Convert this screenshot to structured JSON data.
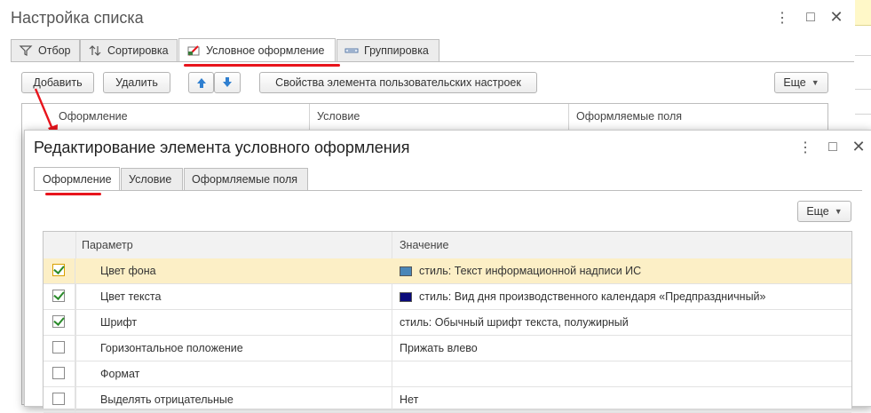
{
  "outer_window": {
    "title": "Настройка списка",
    "tabs": [
      {
        "label": "Отбор",
        "icon": "filter-icon"
      },
      {
        "label": "Сортировка",
        "icon": "sort-icon"
      },
      {
        "label": "Условное оформление",
        "icon": "conditional-format-icon",
        "active": true
      },
      {
        "label": "Группировка",
        "icon": "grouping-icon"
      }
    ],
    "toolbar": {
      "add": "Добавить",
      "delete": "Удалить",
      "properties": "Свойства элемента пользовательских настроек",
      "more": "Еще"
    },
    "columns": [
      "Оформление",
      "Условие",
      "Оформляемые поля"
    ]
  },
  "dialog": {
    "title": "Редактирование элемента условного оформления",
    "tabs": [
      {
        "label": "Оформление",
        "active": true
      },
      {
        "label": "Условие"
      },
      {
        "label": "Оформляемые поля"
      }
    ],
    "more": "Еще",
    "columns": {
      "param": "Параметр",
      "value": "Значение"
    },
    "rows": [
      {
        "checked": true,
        "param": "Цвет фона",
        "value": "стиль: Текст информационной надписи ИС",
        "swatch": "#4a86b8",
        "selected": true
      },
      {
        "checked": true,
        "param": "Цвет текста",
        "value": "стиль: Вид дня производственного календаря «Предпраздничный»",
        "swatch": "#0a0a7a"
      },
      {
        "checked": true,
        "param": "Шрифт",
        "value": "стиль: Обычный шрифт текста, полужирный"
      },
      {
        "checked": false,
        "param": "Горизонтальное положение",
        "value": "Прижать влево"
      },
      {
        "checked": false,
        "param": "Формат",
        "value": ""
      },
      {
        "checked": false,
        "param": "Выделять отрицательные",
        "value": "Нет"
      }
    ]
  },
  "colors": {
    "accent_red": "#e8141c",
    "selection": "#fcefc6",
    "check_green": "#2a8a2a"
  }
}
